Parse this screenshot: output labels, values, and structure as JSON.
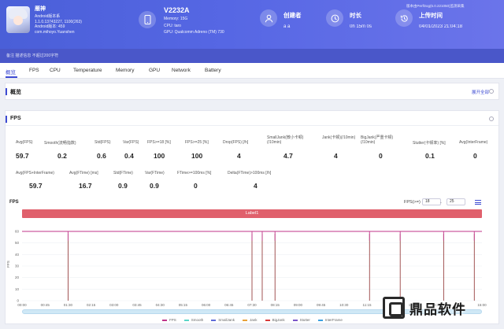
{
  "header": {
    "user": {
      "name": "雁神",
      "lines": [
        "Android版本系",
        "1.1.0.13743227, 1100(263)",
        "Android版本: 459",
        "com.mihoyo.Yuanshen"
      ]
    },
    "device": {
      "model": "V2232A",
      "memory": "Memory: 15G",
      "cpu": "CPU: taro",
      "gpu": "GPU: Qualcomm Adreno (TM) 730"
    },
    "creator": {
      "label": "创建者",
      "value": "a a"
    },
    "duration": {
      "label": "时长",
      "value": "0h 15m 0s"
    },
    "upload": {
      "label": "上传时间",
      "value": "04/01/2023 21:04:18"
    },
    "version_note": "版本由PerfDog(5.0.221050)监测采集",
    "ribbon_note": "备注   描述信息   不超过200字符"
  },
  "tabs": [
    "概览",
    "FPS",
    "CPU",
    "Temperature",
    "Memory",
    "GPU",
    "Network",
    "Battery"
  ],
  "overview": {
    "title": "概览",
    "fold_label": "展开全部"
  },
  "fps_section": {
    "title": "FPS",
    "row1": [
      {
        "label": "Avg(FPS)",
        "value": "59.7"
      },
      {
        "label": "Smooth(流畅指数)",
        "value": "0.2"
      },
      {
        "label": "Std(FPS)",
        "value": "0.6"
      },
      {
        "label": "Var(FPS)",
        "value": "0.4"
      },
      {
        "label": "FPS>=18 [%]",
        "value": "100"
      },
      {
        "label": "FPS>=25 [%]",
        "value": "100"
      },
      {
        "label": "Drop(FPS) [/h]",
        "value": "4"
      },
      {
        "label": "SmallJank(微小卡顿)(/10min)",
        "value": "4.7"
      },
      {
        "label": "Jank(卡顿)(/10min)",
        "value": "4"
      },
      {
        "label": "BigJank(严重卡顿)(/10min)",
        "value": "0"
      },
      {
        "label": "Stutter(卡顿率) [%]",
        "value": "0.1"
      },
      {
        "label": "Avg(InterFrame)",
        "value": "0"
      }
    ],
    "row2": [
      {
        "label": "Avg(FPS+InterFrame)",
        "value": "59.7"
      },
      {
        "label": "Avg(FTime) [ms]",
        "value": "16.7"
      },
      {
        "label": "Std(FTime)",
        "value": "0.9"
      },
      {
        "label": "Var(FTime)",
        "value": "0.9"
      },
      {
        "label": "FTime>=100ms [%]",
        "value": "0"
      },
      {
        "label": "Delta(FTime)>100ms [/h]",
        "value": "4"
      }
    ]
  },
  "chart_data": {
    "type": "line",
    "title": "FPS",
    "label_bar": "Label1",
    "ylabel": "FPS",
    "ylim": [
      0,
      60
    ],
    "y_ticks": [
      "60",
      "50",
      "40",
      "30",
      "20",
      "10",
      "0"
    ],
    "x_ticks": [
      "00:00",
      "00:45",
      "01:30",
      "02:15",
      "03:00",
      "03:45",
      "04:30",
      "05:15",
      "06:00",
      "06:45",
      "07:30",
      "08:15",
      "09:00",
      "09:45",
      "10:30",
      "11:15",
      "12:00",
      "12:45",
      "13:30",
      "14:15",
      "15:00"
    ],
    "fps_threshold_label": "FPS(>=)",
    "fps_threshold_values": [
      "18",
      "25"
    ],
    "series": [
      {
        "name": "FPS",
        "values": [
          60,
          60,
          60,
          60,
          60,
          60,
          60,
          60,
          60,
          60,
          60,
          60,
          60,
          60,
          60,
          60,
          60,
          60,
          60,
          60,
          60
        ]
      },
      {
        "name": "Smooth",
        "values": []
      },
      {
        "name": "SmallJank",
        "values": []
      },
      {
        "name": "Jank",
        "values": []
      },
      {
        "name": "BigJank",
        "values": []
      },
      {
        "name": "Stutter",
        "values": []
      },
      {
        "name": "InterFrame",
        "values": []
      }
    ],
    "spikes_x": [
      "01:30",
      "07:30",
      "07:50",
      "08:15",
      "11:20",
      "12:20",
      "13:45",
      "14:45"
    ],
    "colors": {
      "FPS": "#c0348a",
      "Smooth": "#5ad5c8",
      "SmallJank": "#5e6bd8",
      "Jank": "#e8a13a",
      "BigJank": "#d93a3a",
      "Stutter": "#7a56c9",
      "InterFrame": "#3aa0e0"
    }
  },
  "brand": {
    "name": "鼎品软件"
  }
}
